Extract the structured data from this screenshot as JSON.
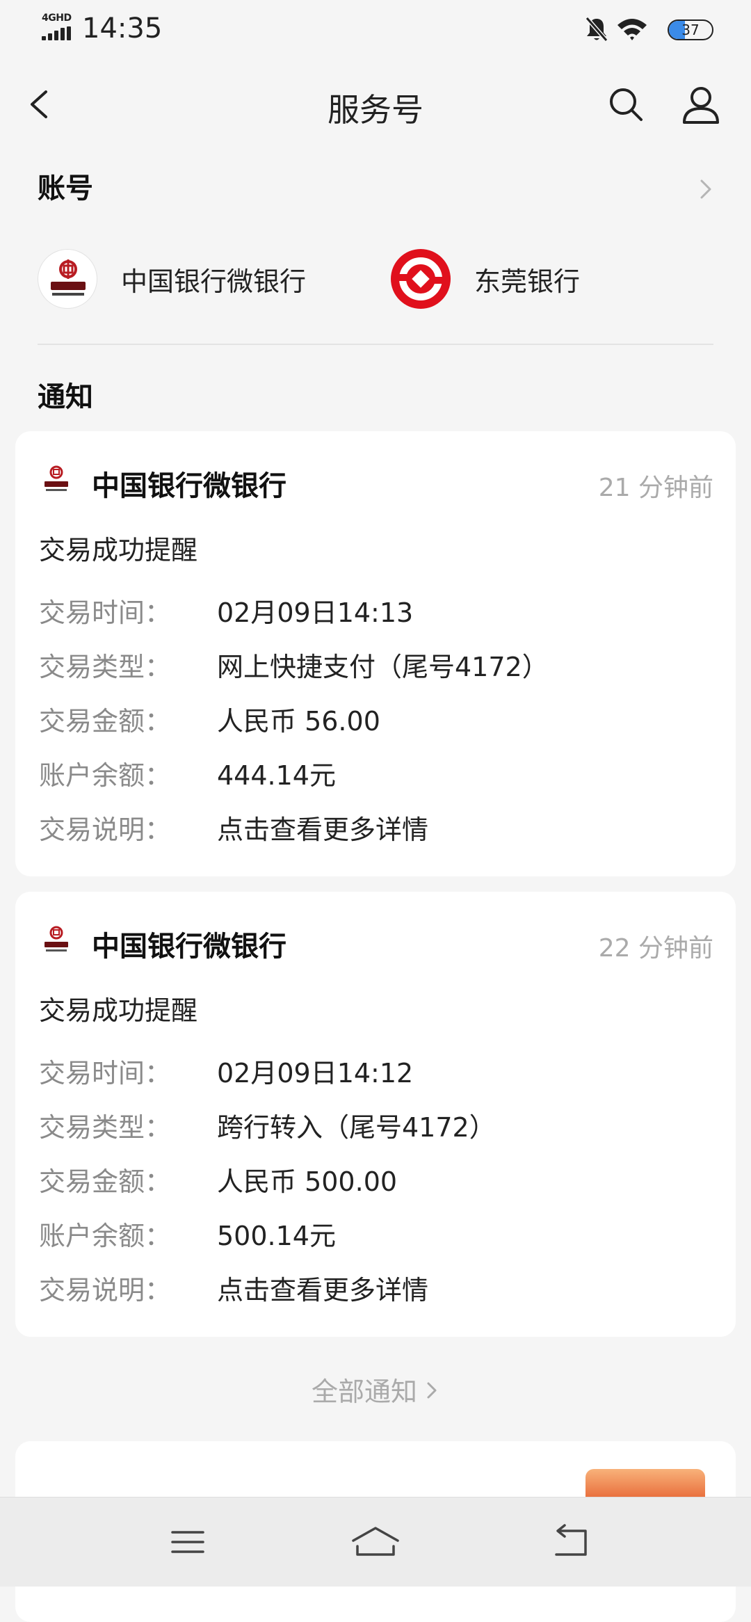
{
  "status_bar": {
    "network": "4GHD",
    "time": "14:35",
    "battery": "37",
    "battery_level": 0.37
  },
  "header": {
    "title": "服务号"
  },
  "accounts": {
    "heading": "账号",
    "items": [
      {
        "label": "中国银行微银行"
      },
      {
        "label": "东莞银行"
      }
    ]
  },
  "notices": {
    "heading": "通知",
    "cards": [
      {
        "sender": "中国银行微银行",
        "time": "21 分钟前",
        "title": "交易成功提醒",
        "rows": [
          {
            "key": "交易时间：",
            "value": "02月09日14:13"
          },
          {
            "key": "交易类型：",
            "value": "网上快捷支付（尾号4172）"
          },
          {
            "key": "交易金额：",
            "value": "人民币 56.00"
          },
          {
            "key": "账户余额：",
            "value": "444.14元"
          },
          {
            "key": "交易说明：",
            "value": "点击查看更多详情"
          }
        ]
      },
      {
        "sender": "中国银行微银行",
        "time": "22 分钟前",
        "title": "交易成功提醒",
        "rows": [
          {
            "key": "交易时间：",
            "value": "02月09日14:12"
          },
          {
            "key": "交易类型：",
            "value": "跨行转入（尾号4172）"
          },
          {
            "key": "交易金额：",
            "value": "人民币 500.00"
          },
          {
            "key": "账户余额：",
            "value": "500.14元"
          },
          {
            "key": "交易说明：",
            "value": "点击查看更多详情"
          }
        ]
      }
    ],
    "all_link": "全部通知"
  },
  "colors": {
    "boc_red": "#b81c22",
    "dg_red": "#e0101c",
    "battery_blue": "#3b8be8"
  },
  "icons": {
    "back": "chevron-left-icon",
    "search": "search-icon",
    "profile": "person-icon",
    "nav": [
      "menu-icon",
      "home-icon",
      "back-icon"
    ]
  }
}
